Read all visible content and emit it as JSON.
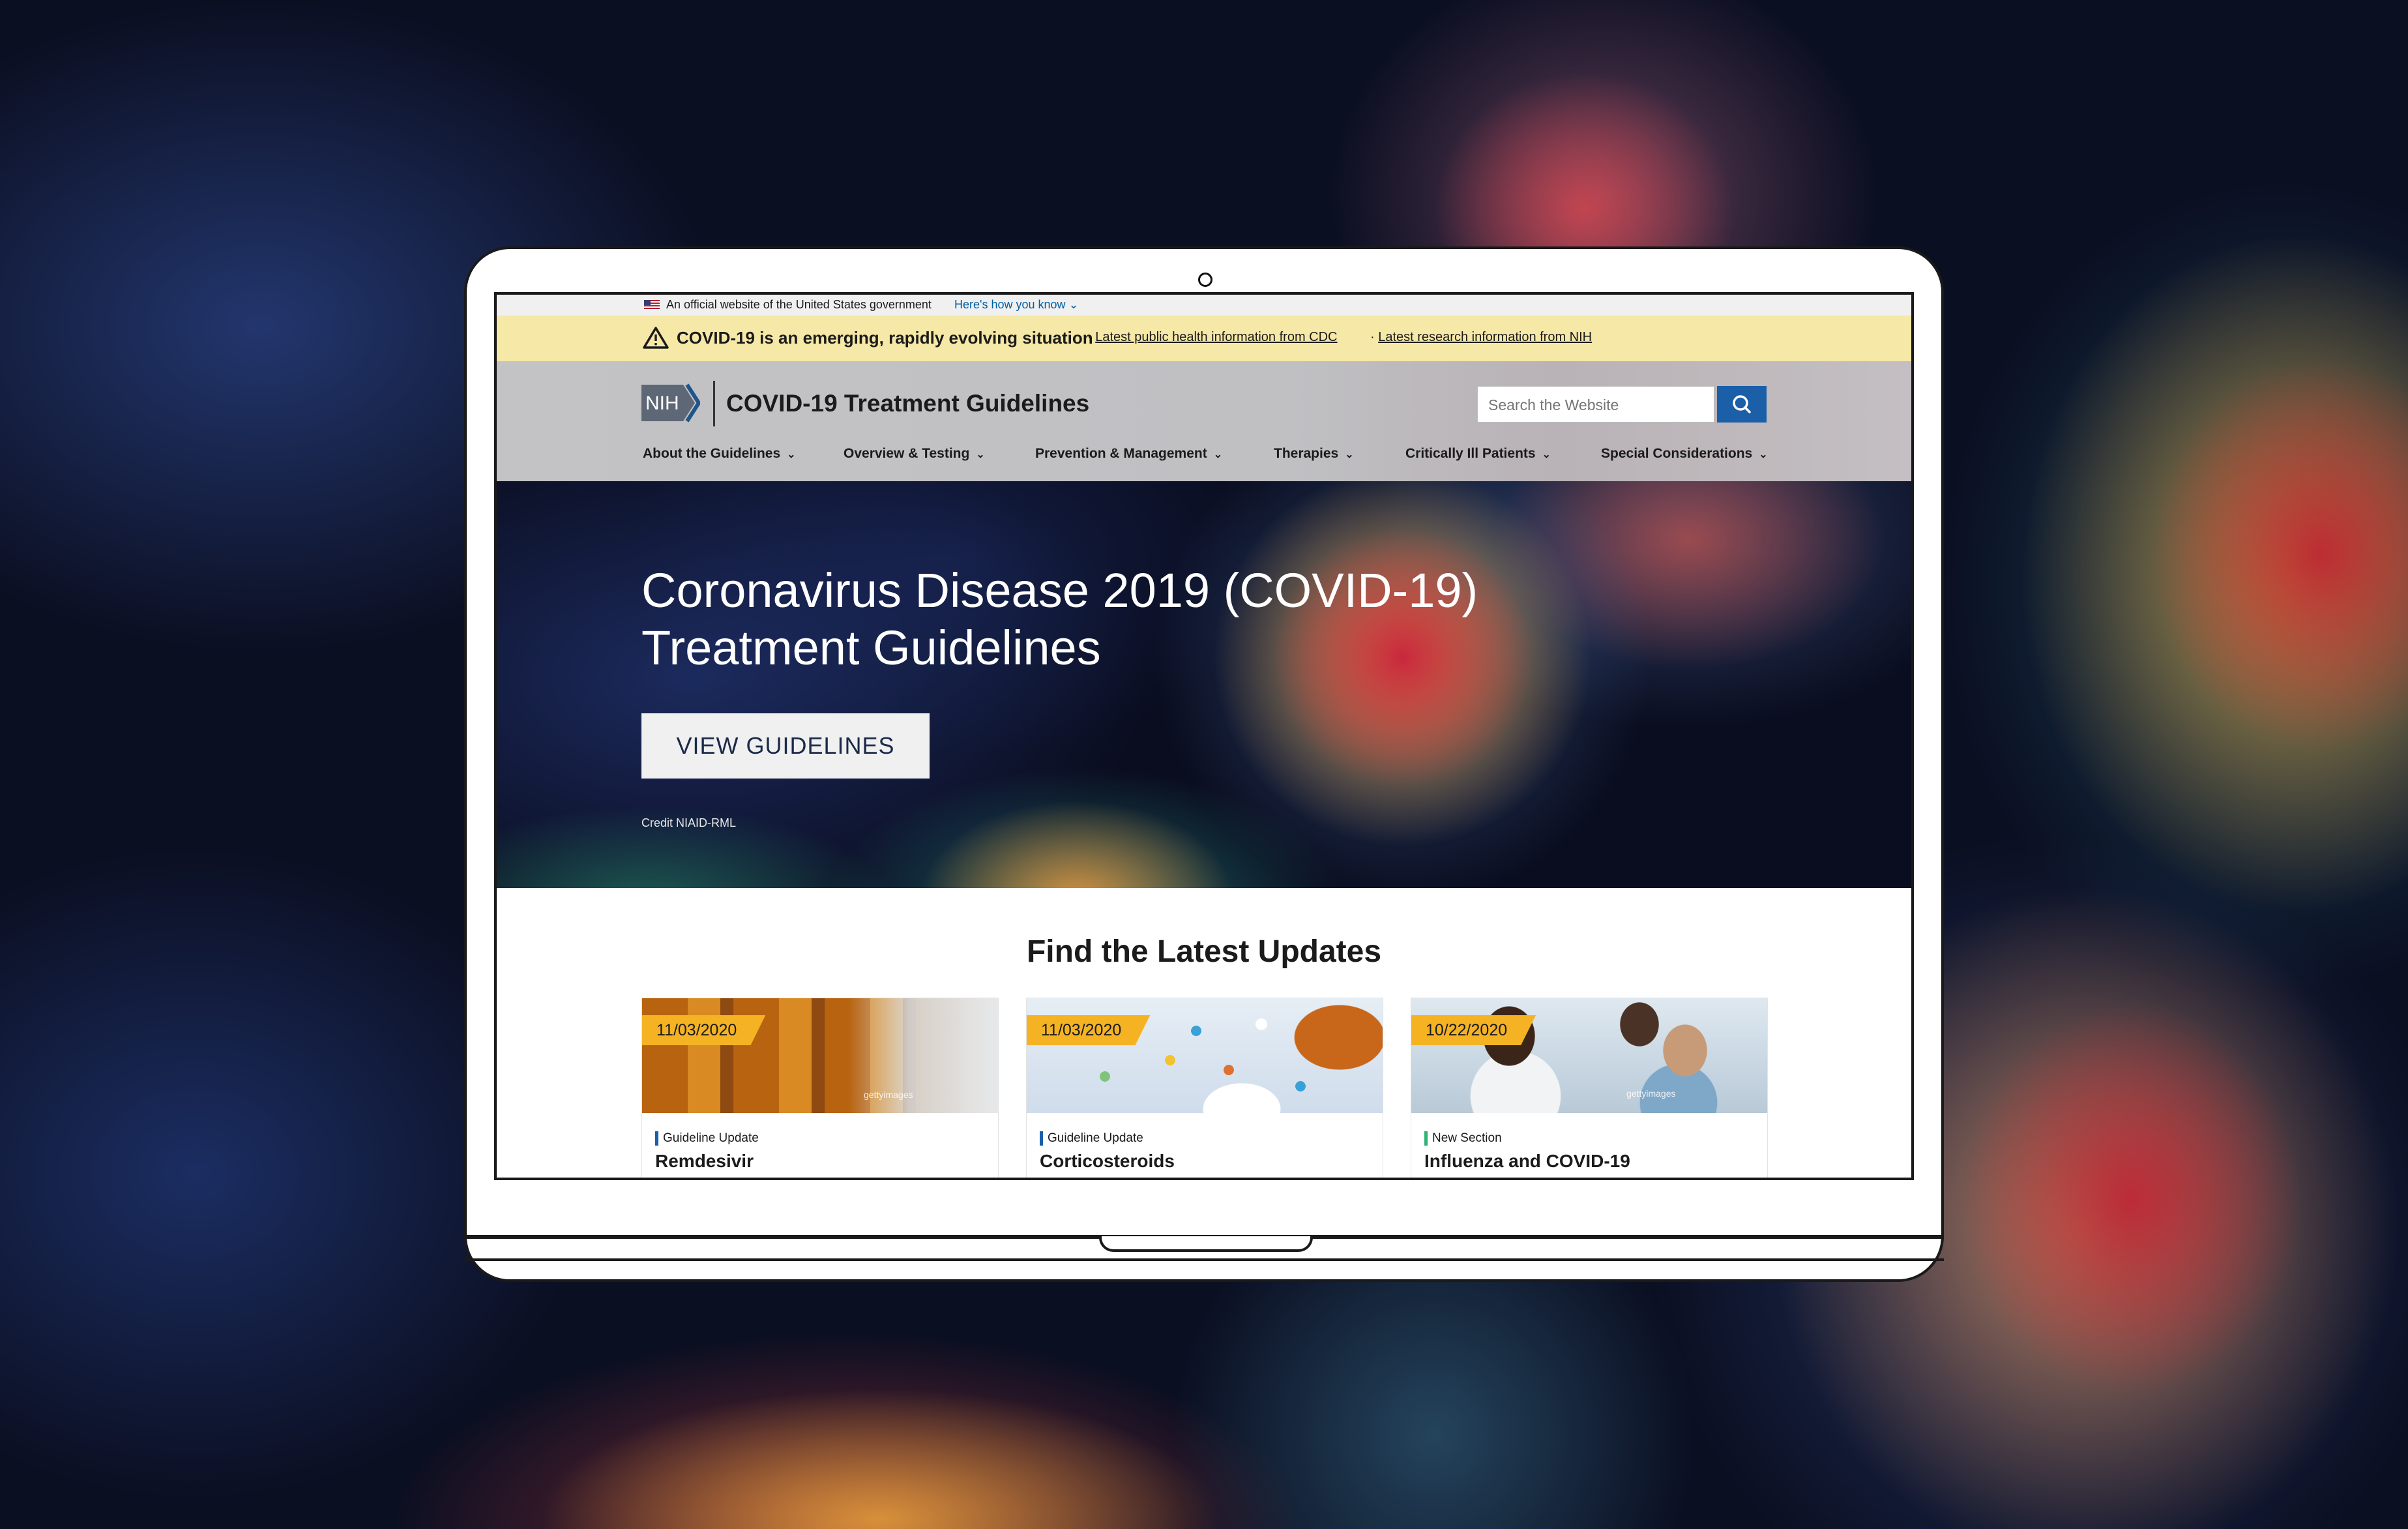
{
  "gov_banner": {
    "text": "An official website of the United States government",
    "link": "Here's how you know"
  },
  "alert": {
    "title": "COVID-19 is an emerging, rapidly evolving situation",
    "links": [
      "Latest public health information from CDC",
      "Latest research information from NIH"
    ]
  },
  "header": {
    "logo_text": "NIH",
    "site_title": "COVID-19 Treatment Guidelines",
    "search_placeholder": "Search the Website",
    "nav": [
      "About the Guidelines",
      "Overview & Testing",
      "Prevention & Management",
      "Therapies",
      "Critically Ill Patients",
      "Special Considerations"
    ]
  },
  "hero": {
    "title_line1": "Coronavirus Disease 2019 (COVID-19)",
    "title_line2": "Treatment Guidelines",
    "button": "VIEW GUIDELINES",
    "credit": "Credit NIAID-RML"
  },
  "updates": {
    "title": "Find the Latest Updates",
    "cards": [
      {
        "date": "11/03/2020",
        "tag": "Guideline Update",
        "title": "Remdesivir",
        "tag_color": "#1a5fa8"
      },
      {
        "date": "11/03/2020",
        "tag": "Guideline Update",
        "title": "Corticosteroids",
        "tag_color": "#1a5fa8"
      },
      {
        "date": "10/22/2020",
        "tag": "New Section",
        "title": "Influenza and COVID-19",
        "tag_color": "#2fb373"
      }
    ]
  },
  "colors": {
    "alert_bg": "#f6e8a6",
    "search_button": "#1a5fa8",
    "date_badge": "#f5b324"
  }
}
